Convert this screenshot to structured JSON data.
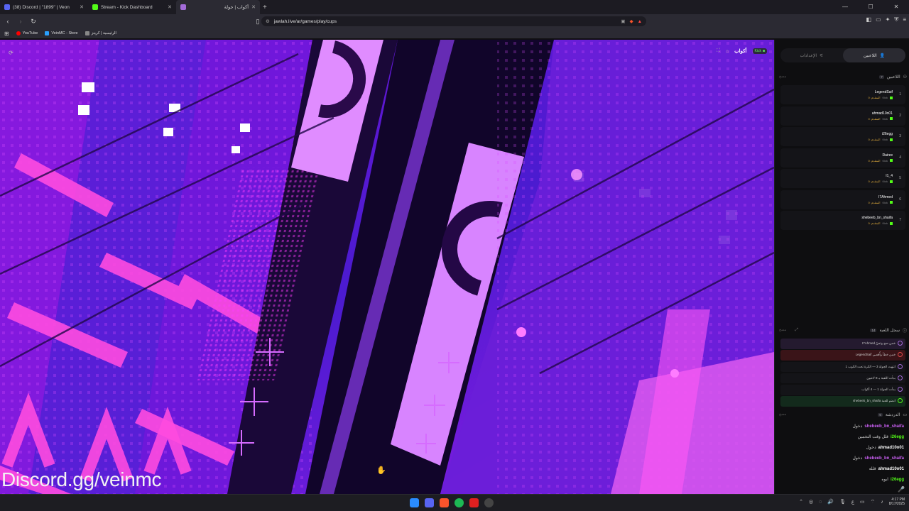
{
  "browser": {
    "tabs": [
      {
        "label": "(38) Discord | \"1899\" | Veon",
        "color": "#5865f2"
      },
      {
        "label": "Stream - Kick Dashboard",
        "color": "#53fc18"
      },
      {
        "label": "أكواب | جولة",
        "color": "#a36bd9"
      }
    ],
    "url": "jawlah.live/ar/games/play/cups",
    "bookmarks": [
      {
        "label": "YouTube",
        "color": "#ff0000"
      },
      {
        "label": "VeinMC - Store",
        "color": "#2aa0ff"
      },
      {
        "label": "الرئيسية | كريتز",
        "color": "#888888"
      }
    ],
    "window_controls": [
      "—",
      "☐",
      "✕"
    ]
  },
  "game": {
    "title": "أكواب",
    "kick_label": "Kick",
    "watermark": "Discord.gg/veinmc"
  },
  "sidebar": {
    "tabs": [
      {
        "label": "اللاعبين",
        "active": true
      },
      {
        "label": "الإعدادات",
        "active": false
      }
    ],
    "players_section": {
      "title": "اللاعبين",
      "count": "7",
      "action": "مسح"
    },
    "players": [
      {
        "name": "LegendSaif",
        "status": "المتقدم: 0",
        "rank": "1"
      },
      {
        "name": "ahmad10o01",
        "status": "المتقدم: 0",
        "rank": "2"
      },
      {
        "name": "i26egg",
        "status": "المتقدم: 0",
        "rank": "3"
      },
      {
        "name": "Rairex",
        "status": "المتقدم: 0",
        "rank": "4"
      },
      {
        "name": "I1_4",
        "status": "المتقدم: 0",
        "rank": "5"
      },
      {
        "name": "I7Ahmed",
        "status": "المتقدم: 0",
        "rank": "6"
      },
      {
        "name": "shebeeb_bn_shaifa",
        "status": "المتقدم: 0",
        "rank": "7"
      }
    ],
    "kick_tag": "Kick",
    "log_section": {
      "title": "سجل اللعبة",
      "count": "14",
      "action": "مسح"
    },
    "log": [
      {
        "text": "I7Ahmed خمن صح وتجنّ",
        "bg": "#241a2f",
        "color": "#a36bd9"
      },
      {
        "text": "LegendSaif خمن خطأ وأُقصي",
        "bg": "#3a1418",
        "color": "#e04848"
      },
      {
        "text": "انتهت الجولة 3 — الكرة تحت الكوب 1",
        "bg": "#141418",
        "color": "#a36bd9"
      },
      {
        "text": "بدأت اللعبة بـ 8 لاعبين",
        "bg": "#141418",
        "color": "#a36bd9"
      },
      {
        "text": "بدأت الجولة 1 — 4 أكواب",
        "bg": "#141418",
        "color": "#a36bd9"
      },
      {
        "text": "shebeeb_bn_shaifa انضم للعبة",
        "bg": "#132a1c",
        "color": "#53fc18"
      }
    ],
    "chat_section": {
      "title": "الدردشة",
      "count": "6",
      "action": "مسح"
    },
    "chat": [
      {
        "user": "shebeeb_bn_shaifa",
        "text": "دخول",
        "color": "#c95ff2"
      },
      {
        "user": "i26egg",
        "text": "قلل وقت التخمين",
        "color": "#53fc18"
      },
      {
        "user": "ahmad10o01",
        "text": "دخول",
        "color": "#ffffff"
      },
      {
        "user": "shebeeb_bn_shaifa",
        "text": "دخول",
        "color": "#c95ff2"
      },
      {
        "user": "ahmad10o01",
        "text": "قلله",
        "color": "#ffffff"
      },
      {
        "user": "i26egg",
        "text": "ابوه",
        "color": "#53fc18"
      }
    ]
  },
  "taskbar": {
    "time": "4:17 PM",
    "date": "8/17/2025",
    "lang": "ع"
  }
}
